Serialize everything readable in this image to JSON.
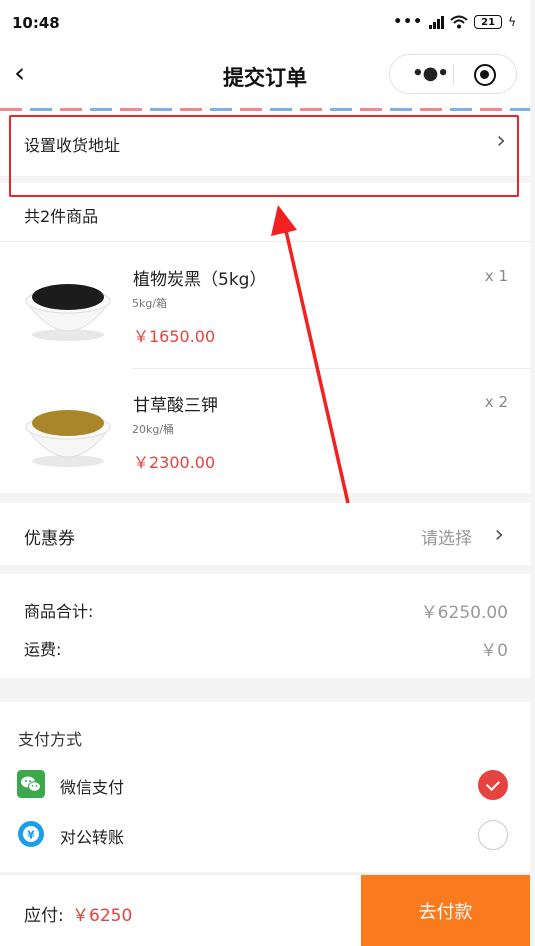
{
  "status_bar": {
    "time": "10:48",
    "battery": "21"
  },
  "nav": {
    "title": "提交订单"
  },
  "address": {
    "label": "设置收货地址"
  },
  "goods": {
    "count_label": "共2件商品",
    "items": [
      {
        "name": "植物炭黑（5kg）",
        "spec": "5kg/箱",
        "price": "￥1650.00",
        "qty": "x 1",
        "color": "#1c1c1c"
      },
      {
        "name": "甘草酸三钾",
        "spec": "20kg/桶",
        "price": "￥2300.00",
        "qty": "x 2",
        "color": "#a9862a"
      }
    ]
  },
  "coupon": {
    "label": "优惠券",
    "hint": "请选择"
  },
  "totals": [
    {
      "label": "商品合计:",
      "value": "￥6250.00"
    },
    {
      "label": "运费:",
      "value": "￥0"
    }
  ],
  "payment": {
    "title": "支付方式",
    "methods": [
      {
        "label": "微信支付",
        "icon": "wechat-pay-icon",
        "checked": true
      },
      {
        "label": "对公转账",
        "icon": "transfer-icon",
        "checked": false
      }
    ]
  },
  "footer": {
    "due_label": "应付:",
    "due_amount": "￥6250",
    "pay_button": "去付款"
  },
  "colors": {
    "price_red": "#e64340",
    "pay_orange": "#fa7a1e",
    "highlight_red": "#e8262a",
    "wechat_green": "#3aa84b",
    "transfer_blue": "#1aa0e8"
  }
}
